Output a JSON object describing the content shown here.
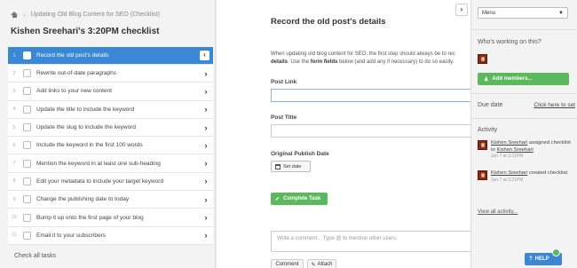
{
  "breadcrumb": {
    "separator": "›",
    "current": "Updating Old Blog Content for SEO (Checklist)"
  },
  "checklist_title": "Kishen Sreehari's 3:20PM checklist",
  "tasks": [
    {
      "num": "1",
      "label": "Record the old post's details"
    },
    {
      "num": "2",
      "label": "Rewrite out-of-date paragraphs"
    },
    {
      "num": "3",
      "label": "Add links to your new content"
    },
    {
      "num": "4",
      "label": "Update the title to include the keyword"
    },
    {
      "num": "5",
      "label": "Update the slug to include the keyword"
    },
    {
      "num": "6",
      "label": "Include the keyword in the first 100 words"
    },
    {
      "num": "7",
      "label": "Mention the keyword in at least one sub-heading"
    },
    {
      "num": "8",
      "label": "Edit your metadata to include your target keyword"
    },
    {
      "num": "9",
      "label": "Change the publishing date to today"
    },
    {
      "num": "10",
      "label": "Bump it up onto the first page of your blog"
    },
    {
      "num": "11",
      "label": "Email it to your subscribers"
    }
  ],
  "task_chevron": "›",
  "active_chevron": "‹",
  "check_all": "Check all tasks",
  "detail": {
    "title": "Record the old post's details",
    "desc_line1": "When updating old blog content for SEO, the first step should always be to rec",
    "desc_line2_bold": "details",
    "desc_line2_a": ". Use the ",
    "desc_line2_bold2": "form fields",
    "desc_line2_b": " below (and add any if necessary) to do so easily.",
    "post_link_label": "Post Link",
    "post_title_label": "Post Title",
    "publish_date_label": "Original Publish Date",
    "set_date": "Set date",
    "complete_task": "Complete Task",
    "comment_placeholder": "Write a comment... Type @ to mention other users.",
    "comment_btn": "Comment",
    "attach_btn": "Attach"
  },
  "right": {
    "collapse_glyph": "›",
    "menu_label": "Menu",
    "working_on": "Who's working on this?",
    "add_members": "Add members...",
    "due_date": "Due date",
    "click_to_set": "Click here to set",
    "activity": "Activity",
    "activities": [
      {
        "user": "Kishen Sreehari",
        "action": " assigned checklist to ",
        "target": "Kishen Sreehari",
        "time": "Jun 7 at 3:21PM"
      },
      {
        "user": "Kishen Sreehari",
        "action": " created checklist.",
        "target": "",
        "time": "Jun 7 at 3:21PM"
      }
    ],
    "view_all": "View all activity...",
    "help": "HELP"
  },
  "colors": {
    "active_blue": "#3a87d6",
    "green": "#5cb85c"
  }
}
